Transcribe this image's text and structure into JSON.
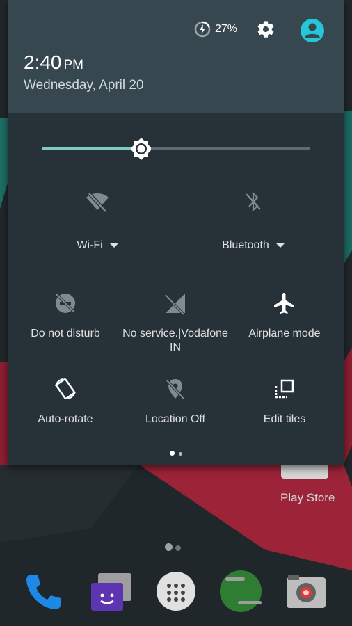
{
  "status": {
    "battery_percent": "27%",
    "battery_level": 0.27
  },
  "clock": {
    "time": "2:40",
    "ampm": "PM",
    "date": "Wednesday, April 20"
  },
  "brightness": {
    "level": 0.37
  },
  "big_tiles": {
    "wifi": {
      "label": "Wi-Fi",
      "icon": "wifi-off-icon"
    },
    "bluetooth": {
      "label": "Bluetooth",
      "icon": "bluetooth-off-icon"
    }
  },
  "tiles": {
    "dnd": {
      "label": "Do not disturb",
      "icon": "do-not-disturb-icon"
    },
    "cellular": {
      "label": "No service.|Vodafone IN",
      "icon": "no-signal-icon"
    },
    "airplane": {
      "label": "Airplane mode",
      "icon": "airplane-icon"
    },
    "rotate": {
      "label": "Auto-rotate",
      "icon": "auto-rotate-icon"
    },
    "location": {
      "label": "Location Off",
      "icon": "location-off-icon"
    },
    "edit": {
      "label": "Edit tiles",
      "icon": "edit-tiles-icon"
    }
  },
  "pager": {
    "pages": 2,
    "current": 1
  },
  "home": {
    "play_store_label": "Play Store"
  },
  "colors": {
    "shade_bg": "#263238",
    "header_bg": "#37474f",
    "accent": "#80cbc4",
    "user_icon": "#26c6da"
  }
}
